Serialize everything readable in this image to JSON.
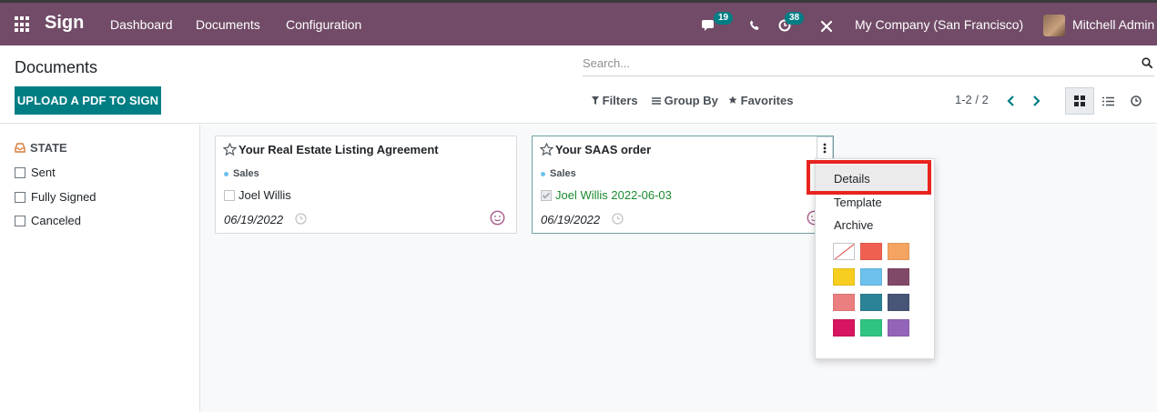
{
  "topbar": {
    "app_name": "Sign",
    "menu": [
      "Dashboard",
      "Documents",
      "Configuration"
    ],
    "messages_count": "19",
    "activities_count": "38",
    "company": "My Company (San Francisco)",
    "user": "Mitchell Admin",
    "brand_color": "#714b67"
  },
  "control_panel": {
    "breadcrumb": "Documents",
    "upload_button": "UPLOAD A PDF TO SIGN",
    "search_placeholder": "Search...",
    "filters_label": "Filters",
    "group_by_label": "Group By",
    "favorites_label": "Favorites",
    "pager": "1-2 / 2"
  },
  "sidebar": {
    "section_title": "STATE",
    "items": [
      "Sent",
      "Fully Signed",
      "Canceled"
    ]
  },
  "cards": [
    {
      "title": "Your Real Estate Listing Agreement",
      "tag": "Sales",
      "signer": "Joel Willis",
      "signed": false,
      "date": "06/19/2022"
    },
    {
      "title": "Your SAAS order",
      "tag": "Sales",
      "signer": "Joel Willis 2022-06-03",
      "signed": true,
      "date": "06/19/2022"
    }
  ],
  "dropdown": {
    "items": [
      "Details",
      "Template",
      "Archive"
    ],
    "highlighted": "Details",
    "colors": [
      "none",
      "#f06050",
      "#f4a460",
      "#f7cd1f",
      "#6cc1ed",
      "#814968",
      "#eb7e7f",
      "#2c8397",
      "#475577",
      "#d6145f",
      "#30c381",
      "#9365b8"
    ]
  },
  "accent_color": "#017e84"
}
